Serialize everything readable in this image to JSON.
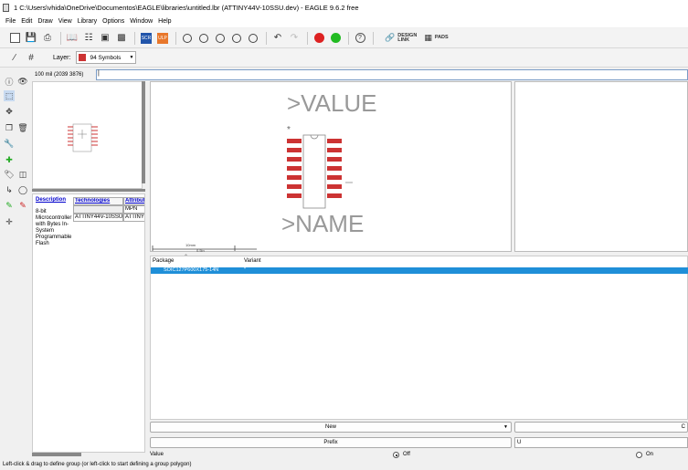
{
  "window": {
    "title": "1 C:\\Users\\vhida\\OneDrive\\Documentos\\EAGLE\\libraries\\untitled.lbr (ATTINY44V-10SSU.dev) - EAGLE 9.6.2 free"
  },
  "menu": [
    "File",
    "Edit",
    "Draw",
    "View",
    "Library",
    "Options",
    "Window",
    "Help"
  ],
  "toolbar": {
    "scr_label": "SCR",
    "ulp_label": "ULP",
    "help_label": "?",
    "design_link_line1": "DESIGN",
    "design_link_line2": "LINK",
    "pads_label": "PADS"
  },
  "params": {
    "layer_label": "Layer:",
    "layer_value": "94 Symbols",
    "layer_color": "#cc3333"
  },
  "coord": {
    "text": "100 mil (2039 3876)"
  },
  "command": {
    "value": "|"
  },
  "description": {
    "header": "Description",
    "text": "8-bit Microcontroller with Bytes In-System Programmable Flash"
  },
  "technologies": {
    "header": "Technologies",
    "attrib_header": "Attribut",
    "mpn_label": "MPN",
    "row_tech": "ATTINY44V-10SSU",
    "row_attrib": "ATTINY4"
  },
  "symbol": {
    "value_text": ">VALUE",
    "name_text": ">NAME",
    "star": "*",
    "scale_label": "10mm",
    "scale_sub": "0.5in"
  },
  "package_table": {
    "col_package": "Package",
    "col_variant": "Variant",
    "row_package": "SOIC127P600X175-14N",
    "row_variant": "''"
  },
  "buttons": {
    "new_label": "New",
    "prefix_label": "Prefix",
    "right_btn_label": "C",
    "right_input_value": "U"
  },
  "value_row": {
    "label": "Value",
    "off_label": "Off",
    "on_label": "On"
  },
  "status": {
    "text": "Left-click & drag to define group (or left-click to start defining a group polygon)"
  }
}
